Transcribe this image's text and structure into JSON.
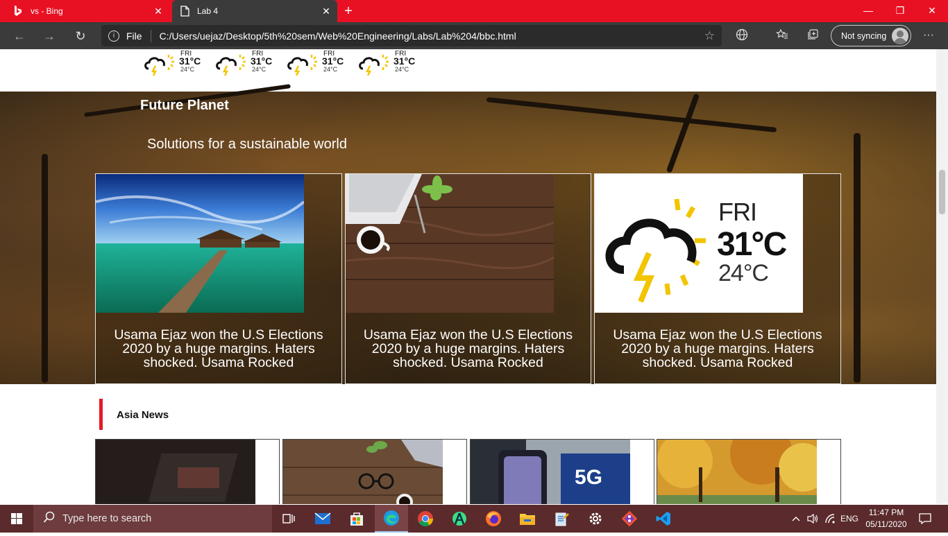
{
  "browser": {
    "tabs": [
      {
        "title": "vs - Bing",
        "icon": "bing-icon",
        "active": false
      },
      {
        "title": "Lab 4",
        "icon": "page-icon",
        "active": true
      }
    ],
    "close_glyph": "✕",
    "new_tab_glyph": "+",
    "window_controls": {
      "minimize": "—",
      "restore": "❐",
      "close": "✕"
    },
    "nav": {
      "back": "←",
      "forward": "→",
      "refresh": "↻"
    },
    "address": {
      "info_glyph": "i",
      "scheme_label": "File",
      "url": "C:/Users/uejaz/Desktop/5th%20sem/Web%20Engineering/Labs/Lab%204/bbc.html",
      "star_glyph": "☆"
    },
    "sync_label": "Not syncing",
    "more_glyph": "···"
  },
  "page": {
    "weather_strip": [
      {
        "day": "FRI",
        "high": "31°C",
        "low": "24°C"
      },
      {
        "day": "FRI",
        "high": "31°C",
        "low": "24°C"
      },
      {
        "day": "FRI",
        "high": "31°C",
        "low": "24°C"
      },
      {
        "day": "FRI",
        "high": "31°C",
        "low": "24°C"
      }
    ],
    "future_planet": {
      "title": "Future Planet",
      "subtitle": "Solutions for a sustainable world",
      "cards": [
        {
          "image": "maldives-pier-image",
          "caption": "Usama Ejaz won the U.S Elections 2020 by a huge margins. Haters shocked. Usama Rocked"
        },
        {
          "image": "desk-coffee-image",
          "caption": "Usama Ejaz won the U.S Elections 2020 by a huge margins. Haters shocked. Usama Rocked"
        },
        {
          "image": "weather-forecast-image",
          "caption": "Usama Ejaz won the U.S Elections 2020 by a huge margins. Haters shocked. Usama Rocked",
          "weather": {
            "day": "FRI",
            "high": "31°C",
            "low": "24°C"
          }
        }
      ]
    },
    "asia_news": {
      "title": "Asia News",
      "cards": [
        {
          "image": "laptop-dark-image"
        },
        {
          "image": "desk-glasses-image"
        },
        {
          "image": "5g-phone-image",
          "badge": "5G"
        },
        {
          "image": "autumn-park-image"
        }
      ]
    }
  },
  "taskbar": {
    "search_placeholder": "Type here to search",
    "apps": [
      "task-view",
      "mail",
      "store",
      "edge",
      "chrome",
      "android-studio",
      "firefox",
      "file-explorer",
      "notepad",
      "settings",
      "git",
      "vscode"
    ],
    "tray": {
      "language": "ENG",
      "time": "11:47 PM",
      "date": "05/11/2020"
    }
  },
  "colors": {
    "titlebar": "#e81123",
    "toolbar": "#3b3b3b",
    "taskbar": "#5a2a2c",
    "accent_red": "#e31b23"
  }
}
